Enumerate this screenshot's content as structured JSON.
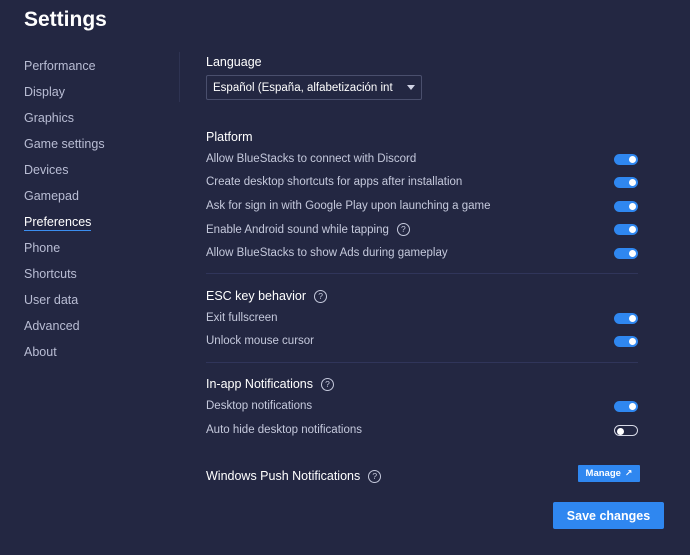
{
  "window": {
    "title": "Settings"
  },
  "sidebar": {
    "items": [
      {
        "label": "Performance"
      },
      {
        "label": "Display"
      },
      {
        "label": "Graphics"
      },
      {
        "label": "Game settings"
      },
      {
        "label": "Devices"
      },
      {
        "label": "Gamepad"
      },
      {
        "label": "Preferences",
        "active": true
      },
      {
        "label": "Phone"
      },
      {
        "label": "Shortcuts"
      },
      {
        "label": "User data"
      },
      {
        "label": "Advanced"
      },
      {
        "label": "About"
      }
    ]
  },
  "language": {
    "title": "Language",
    "selected": "Español (España, alfabetización int"
  },
  "platform": {
    "title": "Platform",
    "options": [
      {
        "label": "Allow BlueStacks to connect with Discord",
        "on": true
      },
      {
        "label": "Create desktop shortcuts for apps after installation",
        "on": true
      },
      {
        "label": "Ask for sign in with Google Play upon launching a game",
        "on": true
      },
      {
        "label": "Enable Android sound while tapping",
        "on": true,
        "help": true
      },
      {
        "label": "Allow BlueStacks to show Ads during gameplay",
        "on": true
      }
    ]
  },
  "esc": {
    "title": "ESC key behavior",
    "options": [
      {
        "label": "Exit fullscreen",
        "on": true
      },
      {
        "label": "Unlock mouse cursor",
        "on": true
      }
    ]
  },
  "notifications": {
    "title": "In-app Notifications",
    "options": [
      {
        "label": "Desktop notifications",
        "on": true
      },
      {
        "label": "Auto hide desktop notifications",
        "on": false
      }
    ]
  },
  "push": {
    "label": "Windows Push Notifications",
    "manage_label": "Manage",
    "help_glyph": "?"
  },
  "footer": {
    "save_label": "Save changes"
  },
  "colors": {
    "background": "#232742",
    "accent": "#2f87f0"
  }
}
